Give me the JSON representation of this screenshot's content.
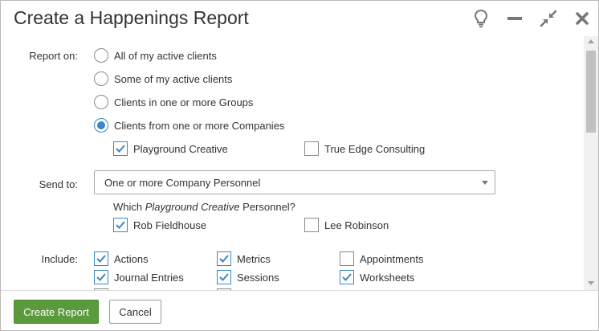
{
  "dialog": {
    "title": "Create a Happenings Report",
    "icons": [
      "lightbulb-icon",
      "minimize-icon",
      "collapse-icon",
      "close-icon"
    ]
  },
  "report_on": {
    "label": "Report on:",
    "options": [
      {
        "label": "All of my active clients",
        "checked": false
      },
      {
        "label": "Some of my active clients",
        "checked": false
      },
      {
        "label": "Clients in one or more Groups",
        "checked": false
      },
      {
        "label": "Clients from one or more Companies",
        "checked": true
      }
    ],
    "companies": [
      {
        "label": "Playground Creative",
        "checked": true
      },
      {
        "label": "True Edge Consulting",
        "checked": false
      }
    ]
  },
  "send_to": {
    "label": "Send to:",
    "selected": "One or more Company Personnel",
    "which_prefix": "Which ",
    "which_company": "Playground Creative",
    "which_suffix": " Personnel?",
    "personnel": [
      {
        "label": "Rob Fieldhouse",
        "checked": true
      },
      {
        "label": "Lee Robinson",
        "checked": false
      }
    ]
  },
  "include": {
    "label": "Include:",
    "items": [
      {
        "label": "Actions",
        "checked": true
      },
      {
        "label": "Metrics",
        "checked": true
      },
      {
        "label": "Appointments",
        "checked": false
      },
      {
        "label": "Journal Entries",
        "checked": true
      },
      {
        "label": "Sessions",
        "checked": true
      },
      {
        "label": "Worksheets",
        "checked": true
      }
    ]
  },
  "footer": {
    "primary_label": "Create Report",
    "secondary_label": "Cancel"
  },
  "colors": {
    "accent_blue": "#3a87c8",
    "primary_green": "#5b9a3c"
  }
}
